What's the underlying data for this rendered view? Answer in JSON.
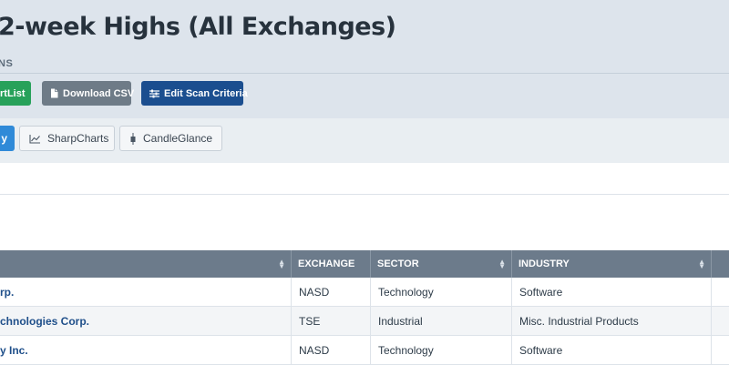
{
  "page": {
    "title": "2-week Highs (All Exchanges)",
    "subtitle": "NS"
  },
  "actions": {
    "chartlist_label": "rtList",
    "download_label": "Download CSV",
    "edit_label": "Edit Scan Criteria"
  },
  "views": {
    "active_label": "y",
    "sharpcharts_label": "SharpCharts",
    "candleglance_label": "CandleGlance"
  },
  "table": {
    "headers": [
      "",
      "EXCHANGE",
      "SECTOR",
      "INDUSTRY"
    ],
    "rows": [
      {
        "name": "rp.",
        "exchange": "NASD",
        "sector": "Technology",
        "industry": "Software"
      },
      {
        "name": "chnologies Corp.",
        "exchange": "TSE",
        "sector": "Industrial",
        "industry": "Misc. Industrial Products"
      },
      {
        "name": "y Inc.",
        "exchange": "NASD",
        "sector": "Technology",
        "industry": "Software"
      }
    ]
  },
  "colors": {
    "green_button": "#27a15a",
    "gray_button": "#6e7b87",
    "blue_button": "#1b4e8f",
    "active_tab": "#2f8ad8",
    "table_header": "#6c7b8b",
    "link": "#1f4f8a"
  },
  "icons": {
    "download": "document-icon",
    "edit": "sliders-icon",
    "sharpcharts": "line-chart-icon",
    "candleglance": "candlestick-icon",
    "sort": "sort-arrows-icon"
  }
}
